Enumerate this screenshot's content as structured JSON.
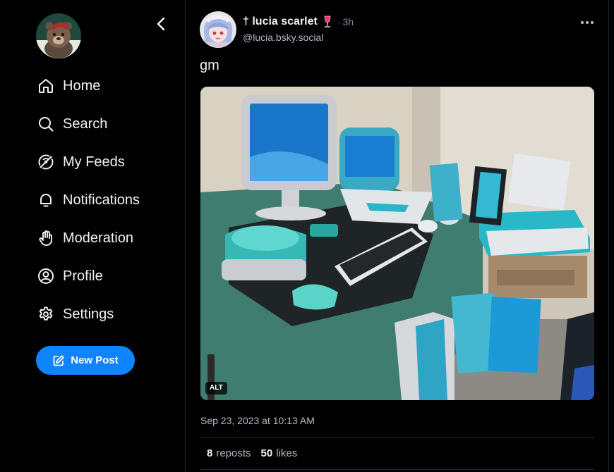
{
  "sidebar": {
    "nav": [
      {
        "label": "Home",
        "icon": "home-icon"
      },
      {
        "label": "Search",
        "icon": "search-icon"
      },
      {
        "label": "My Feeds",
        "icon": "feeds-icon"
      },
      {
        "label": "Notifications",
        "icon": "bell-icon"
      },
      {
        "label": "Moderation",
        "icon": "hand-icon"
      },
      {
        "label": "Profile",
        "icon": "user-icon"
      },
      {
        "label": "Settings",
        "icon": "gear-icon"
      }
    ],
    "new_post_label": "New Post"
  },
  "post": {
    "display_name": "† lucia scarlet",
    "separator": "·",
    "time_ago": "3h",
    "handle": "@lucia.bsky.social",
    "text": "gm",
    "image_alt_badge": "ALT",
    "timestamp": "Sep 23, 2023 at 10:13 AM",
    "reposts_count": "8",
    "reposts_label": "reposts",
    "likes_count": "50",
    "likes_label": "likes"
  },
  "colors": {
    "background": "#000000",
    "accent": "#1083fe",
    "text_primary": "#f1f3f5",
    "text_secondary": "#aebbc9",
    "border": "#1e2936"
  }
}
